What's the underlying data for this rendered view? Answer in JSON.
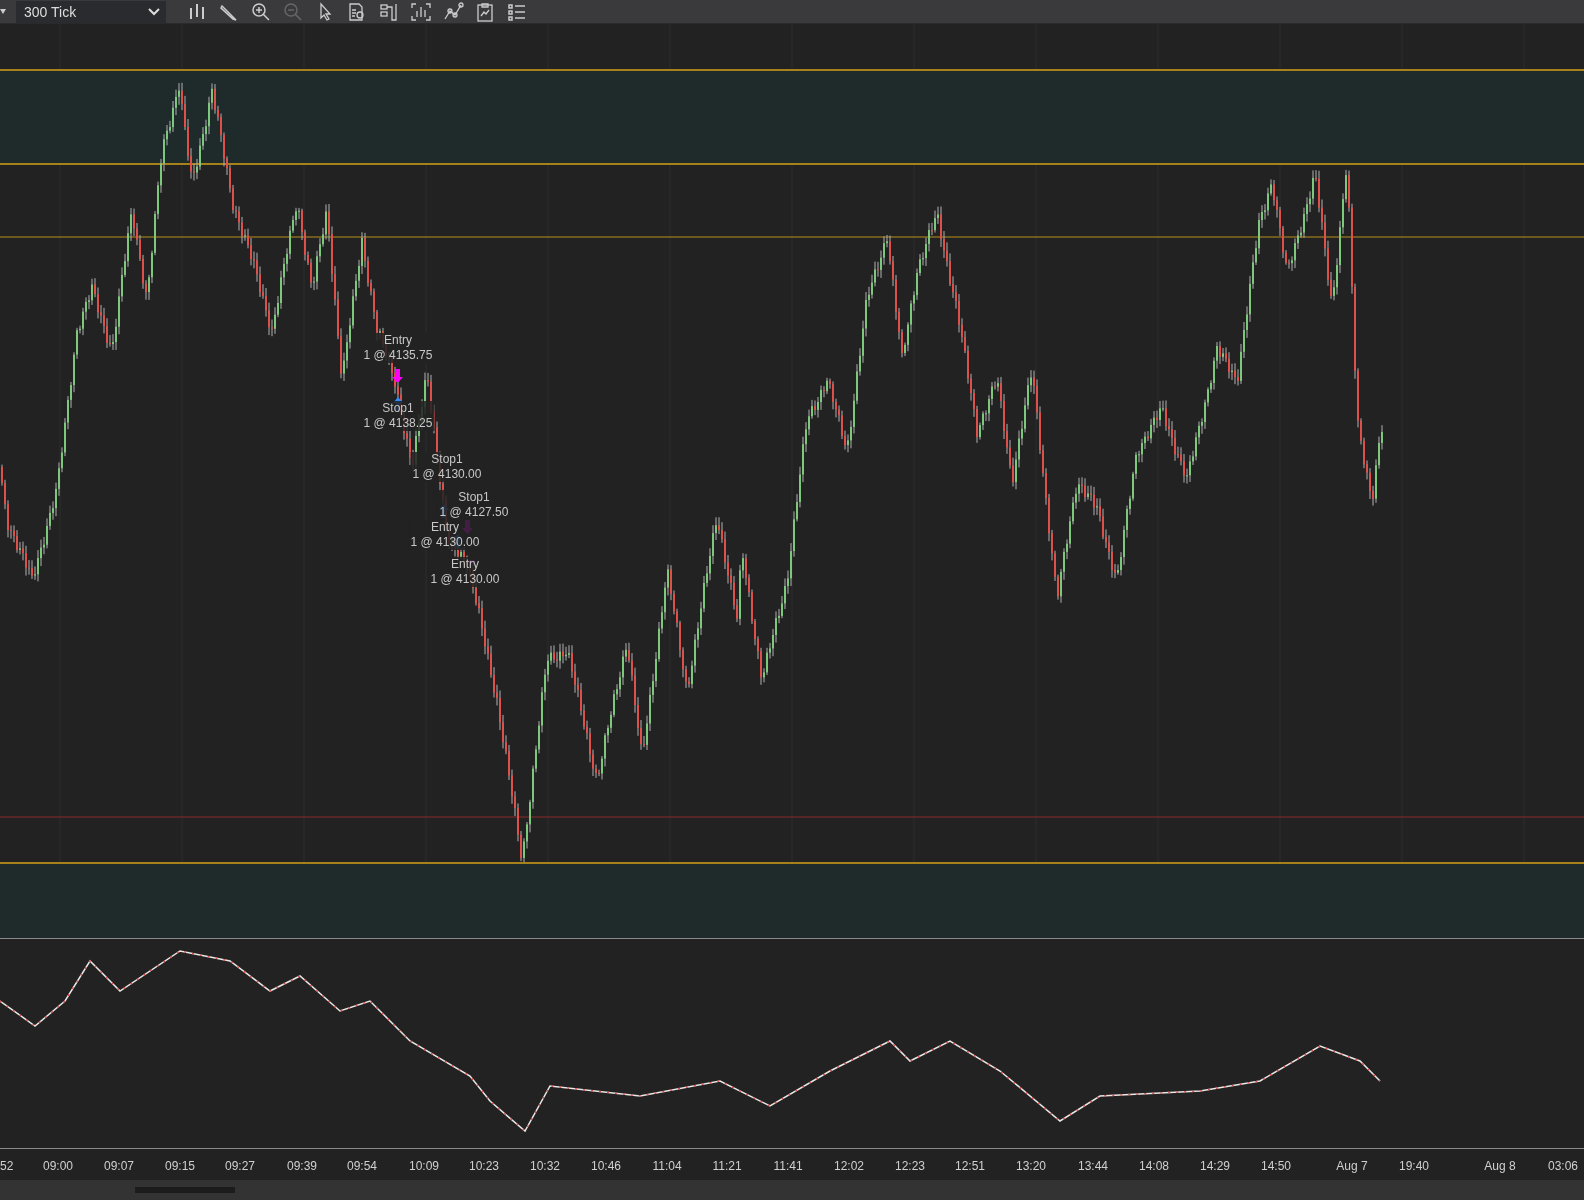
{
  "toolbar": {
    "interval": "300 Tick"
  },
  "trade_labels": [
    {
      "label": "Entry",
      "detail": "1 @ 4135.75"
    },
    {
      "label": "Stop1",
      "detail": "1 @ 4138.25"
    },
    {
      "label": "Stop1",
      "detail": "1 @ 4130.00"
    },
    {
      "label": "Stop1",
      "detail": "1 @ 4127.50"
    },
    {
      "label": "Entry",
      "detail": "1 @ 4130.00"
    },
    {
      "label": "Entry",
      "detail": "1 @ 4130.00"
    }
  ],
  "x_axis": [
    "52",
    "09:00",
    "09:07",
    "09:15",
    "09:27",
    "09:39",
    "09:54",
    "10:09",
    "10:23",
    "10:32",
    "10:46",
    "11:04",
    "11:21",
    "11:41",
    "12:02",
    "12:23",
    "12:51",
    "13:20",
    "13:44",
    "14:08",
    "14:29",
    "14:50",
    "Aug 7",
    "19:40",
    "Aug 8",
    "03:06"
  ]
}
